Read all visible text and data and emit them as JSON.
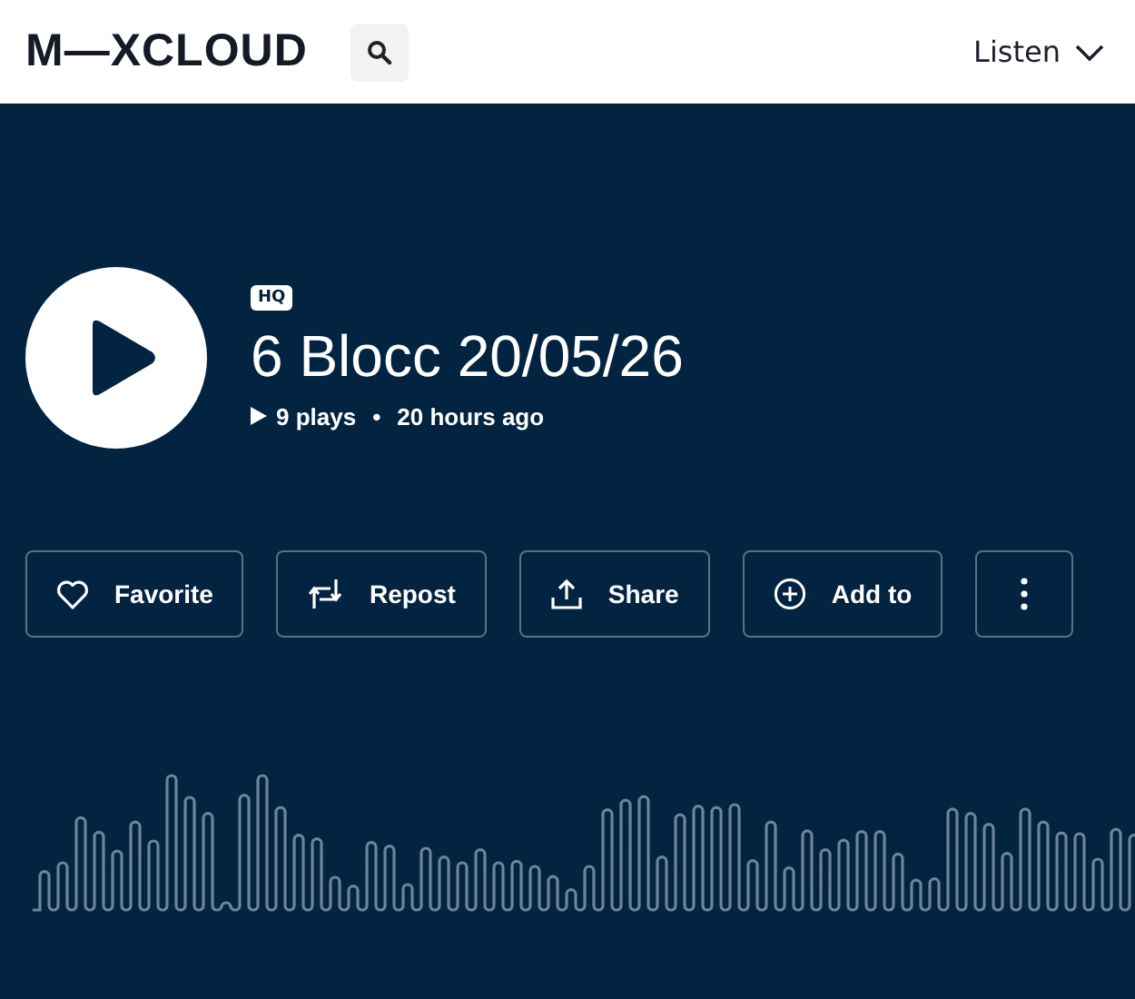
{
  "header": {
    "logo": "M—XCLOUD",
    "menu": {
      "label": "Listen"
    }
  },
  "track": {
    "badge": "HQ",
    "title": "6 Blocc 20/05/26",
    "plays": "9 plays",
    "separator": "•",
    "age": "20 hours ago"
  },
  "actions": [
    {
      "kind": "favorite",
      "label": "Favorite"
    },
    {
      "kind": "repost",
      "label": "Repost"
    },
    {
      "kind": "share",
      "label": "Share"
    },
    {
      "kind": "add",
      "label": "Add to"
    },
    {
      "kind": "more"
    }
  ]
}
